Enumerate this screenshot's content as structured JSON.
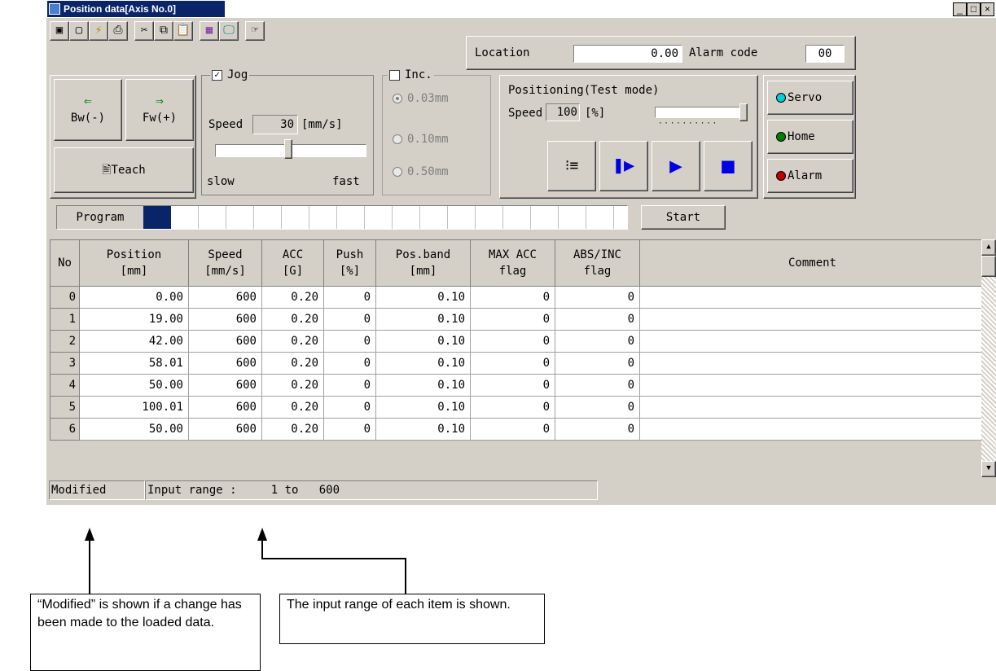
{
  "window": {
    "title": "Position data[Axis No.0]",
    "controls": [
      "_",
      "□",
      "×"
    ]
  },
  "toolbar": {
    "icons": [
      "save-icon",
      "new-icon",
      "transfer-icon",
      "print-icon",
      "cut-icon",
      "copy-icon",
      "paste-icon",
      "table-icon",
      "monitor-icon",
      "pointer-icon"
    ]
  },
  "location": {
    "label": "Location",
    "value": "0.00",
    "alarm_label": "Alarm code",
    "alarm_value": "00"
  },
  "jog_buttons": {
    "bw": "Bw(-)",
    "fw": "Fw(+)",
    "teach": "Teach"
  },
  "jog": {
    "label": "Jog",
    "speed_label": "Speed",
    "speed_value": "30",
    "unit": "[mm/s]",
    "slow": "slow",
    "fast": "fast",
    "slider_level": 0.5
  },
  "inc": {
    "label": "Inc.",
    "options": [
      "0.03mm",
      "0.10mm",
      "0.50mm"
    ],
    "selected": 0
  },
  "positioning": {
    "label": "Positioning(Test mode)",
    "speed_label": "Speed",
    "speed_value": "100",
    "unit": "[%]",
    "slider_level": 1.0
  },
  "status_buttons": {
    "servo": "Servo",
    "home": "Home",
    "alarm": "Alarm"
  },
  "program": {
    "label": "Program",
    "start": "Start"
  },
  "table": {
    "headers": [
      "No",
      "Position\n[mm]",
      "Speed\n[mm/s]",
      "ACC\n[G]",
      "Push\n[%]",
      "Pos.band\n[mm]",
      "MAX ACC\nflag",
      "ABS/INC\nflag",
      "Comment"
    ],
    "rows": [
      [
        "0",
        "0.00",
        "600",
        "0.20",
        "0",
        "0.10",
        "0",
        "0"
      ],
      [
        "1",
        "19.00",
        "600",
        "0.20",
        "0",
        "0.10",
        "0",
        "0"
      ],
      [
        "2",
        "42.00",
        "600",
        "0.20",
        "0",
        "0.10",
        "0",
        "0"
      ],
      [
        "3",
        "58.01",
        "600",
        "0.20",
        "0",
        "0.10",
        "0",
        "0"
      ],
      [
        "4",
        "50.00",
        "600",
        "0.20",
        "0",
        "0.10",
        "0",
        "0"
      ],
      [
        "5",
        "100.01",
        "600",
        "0.20",
        "0",
        "0.10",
        "0",
        "0"
      ],
      [
        "6",
        "50.00",
        "600",
        "0.20",
        "0",
        "0.10",
        "0",
        "0"
      ]
    ]
  },
  "statusbar": {
    "modified": "Modified",
    "input_range": "Input range :     1 to   600"
  },
  "callouts": {
    "modified": "“Modified” is shown if a change has been made to the loaded data.",
    "range": "The input range of each item is shown."
  }
}
